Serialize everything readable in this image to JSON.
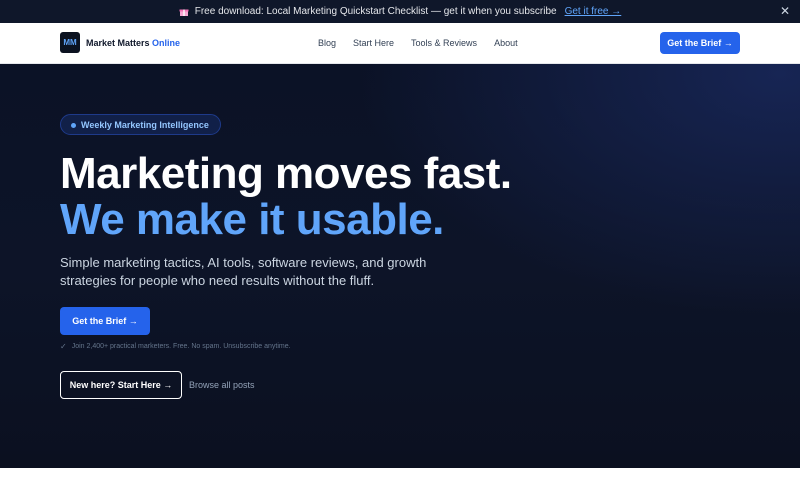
{
  "announcement": {
    "icon": "gift-icon",
    "text": "Free download: Local Marketing Quickstart Checklist — get it when you subscribe",
    "link": "Get it free →",
    "close": "✕"
  },
  "nav": {
    "logo_mark": "MM",
    "brand_main": "Market Matters",
    "brand_accent": "Online",
    "links": [
      "Blog",
      "Start Here",
      "Tools & Reviews",
      "About"
    ],
    "cta": "Get the Brief →"
  },
  "hero": {
    "badge": "Weekly Marketing Intelligence",
    "headline_line1": "Marketing moves fast.",
    "headline_line2": "We make it usable.",
    "subcopy": "Simple marketing tactics, AI tools, software reviews, and growth strategies for people who need results without the fluff.",
    "cta": "Get the Brief →",
    "note": "Join 2,400+ practical marketers. Free. No spam. Unsubscribe anytime.",
    "secondary_cta": "New here? Start Here →",
    "browse_link": "Browse all posts"
  },
  "colors": {
    "accent": "#2563eb",
    "accent_light": "#60a5fa",
    "hero_bg": "#0b1226"
  }
}
